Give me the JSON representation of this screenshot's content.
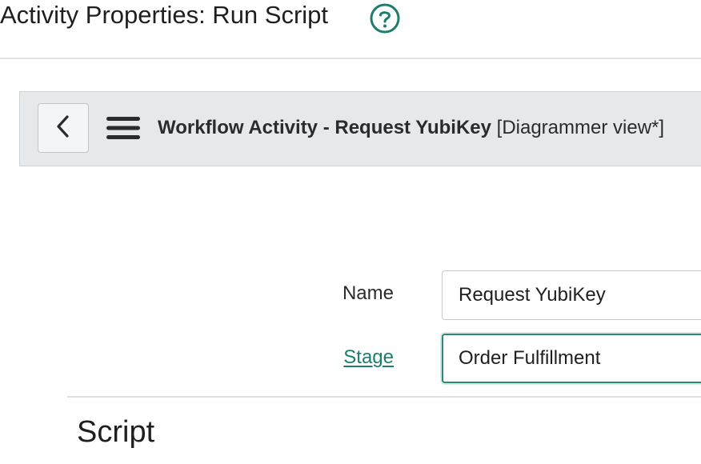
{
  "dialog": {
    "title": "Activity Properties: Run Script",
    "help_icon": "question-circle-icon"
  },
  "form_header": {
    "back_icon": "chevron-left-icon",
    "menu_icon": "hamburger-menu-icon",
    "title_main": "Workflow Activity - Request YubiKey",
    "title_view": "[Diagrammer view*]"
  },
  "fields": {
    "name": {
      "label": "Name",
      "value": "Request YubiKey"
    },
    "stage": {
      "label": "Stage",
      "value": "Order Fulfillment"
    }
  },
  "section": {
    "title": "Script"
  },
  "colors": {
    "accent": "#1d7d6c",
    "focus_border": "#2a8a77",
    "header_bg": "#e6e8ea"
  }
}
